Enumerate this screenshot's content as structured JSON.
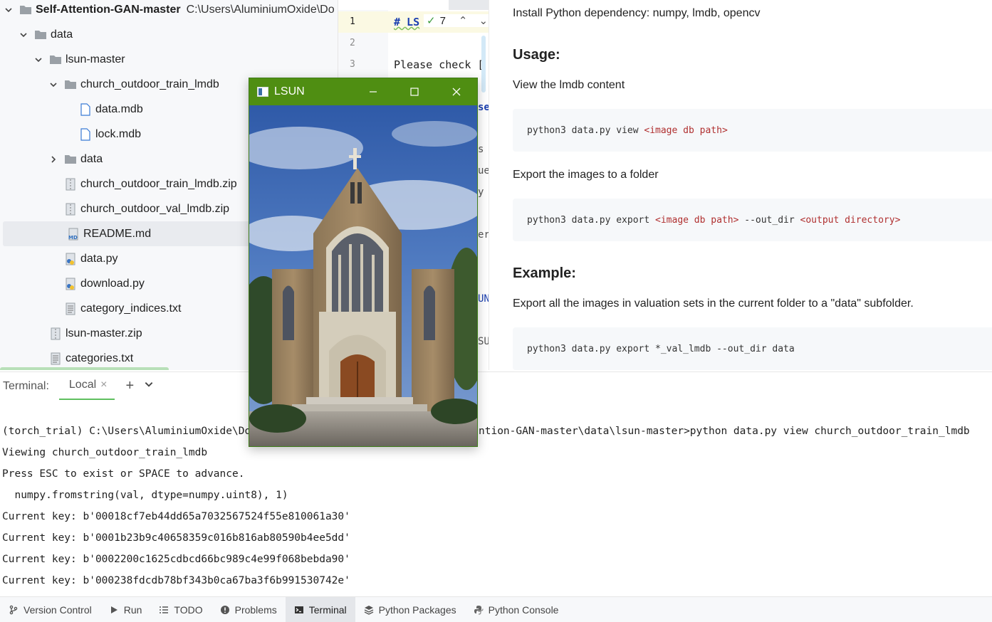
{
  "project_tree": {
    "root": {
      "name": "Self-Attention-GAN-master",
      "path_hint": "C:\\Users\\AluminiumOxide\\Do"
    },
    "items": [
      {
        "label": "data",
        "type": "folder",
        "expanded": true
      },
      {
        "label": "lsun-master",
        "type": "folder",
        "expanded": true
      },
      {
        "label": "church_outdoor_train_lmdb",
        "type": "folder",
        "expanded": true
      },
      {
        "label": "data.mdb",
        "type": "file"
      },
      {
        "label": "lock.mdb",
        "type": "file"
      },
      {
        "label": "data",
        "type": "folder",
        "expanded": false
      },
      {
        "label": "church_outdoor_train_lmdb.zip",
        "type": "zip"
      },
      {
        "label": "church_outdoor_val_lmdb.zip",
        "type": "zip"
      },
      {
        "label": "README.md",
        "type": "markdown",
        "selected": true
      },
      {
        "label": "data.py",
        "type": "python"
      },
      {
        "label": "download.py",
        "type": "python"
      },
      {
        "label": "category_indices.txt",
        "type": "text"
      },
      {
        "label": "lsun-master.zip",
        "type": "zip"
      },
      {
        "label": "categories.txt",
        "type": "text"
      }
    ]
  },
  "editor": {
    "line_numbers": [
      "1",
      "2",
      "3"
    ],
    "line1": "# LS",
    "line3": "Please check [",
    "inspection_count": "7",
    "fragments": [
      "se",
      "s",
      "ue",
      "y",
      "er",
      "UN",
      "SU"
    ]
  },
  "preview": {
    "intro": "Install Python dependency: numpy, lmdb, opencv",
    "usage_heading": "Usage:",
    "view_text": "View the lmdb content",
    "view_cmd_prefix": "python3 data.py view ",
    "view_cmd_arg": "<image db path>",
    "export_text": "Export the images to a folder",
    "export_cmd_prefix": "python3 data.py export ",
    "export_cmd_arg1": "<image db path>",
    "export_cmd_mid": " --out_dir ",
    "export_cmd_arg2": "<output directory>",
    "example_heading": "Example:",
    "example_text": "Export all the images in valuation sets in the current folder to a \"data\" subfolder.",
    "example_cmd": "python3 data.py export *_val_lmdb --out_dir data"
  },
  "terminal": {
    "label": "Terminal:",
    "tab": "Local",
    "prompt_left": "(torch_trial) C:\\Users\\AluminiumOxide\\Do",
    "prompt_right": "ntion-GAN-master\\data\\lsun-master>python data.py view church_outdoor_train_lmdb",
    "lines": [
      "Viewing church_outdoor_train_lmdb",
      "Press ESC to exist or SPACE to advance.",
      "  numpy.fromstring(val, dtype=numpy.uint8), 1)",
      "Current key: b'00018cf7eb44dd65a7032567524f55e810061a30'",
      "Current key: b'0001b23b9c40658359c016b816ab80590b4ee5dd'",
      "Current key: b'0002200c1625cdbcd66bc989c4e99f068bebda90'",
      "Current key: b'000238fdcdb78bf343b0ca67ba3f6b991530742e'"
    ]
  },
  "statusbar": [
    {
      "label": "Version Control",
      "icon": "branch-icon"
    },
    {
      "label": "Run",
      "icon": "play-icon"
    },
    {
      "label": "TODO",
      "icon": "list-icon"
    },
    {
      "label": "Problems",
      "icon": "warning-circle-icon"
    },
    {
      "label": "Terminal",
      "icon": "terminal-icon",
      "active": true
    },
    {
      "label": "Python Packages",
      "icon": "layers-icon"
    },
    {
      "label": "Python Console",
      "icon": "python-icon"
    }
  ],
  "lsun_window": {
    "title": "LSUN",
    "image": "church-photo"
  },
  "colors": {
    "lsun_titlebar": "#4f8e12",
    "active_tab_underline": "#5fbf5f",
    "tree_background": "#f7f8fa"
  }
}
